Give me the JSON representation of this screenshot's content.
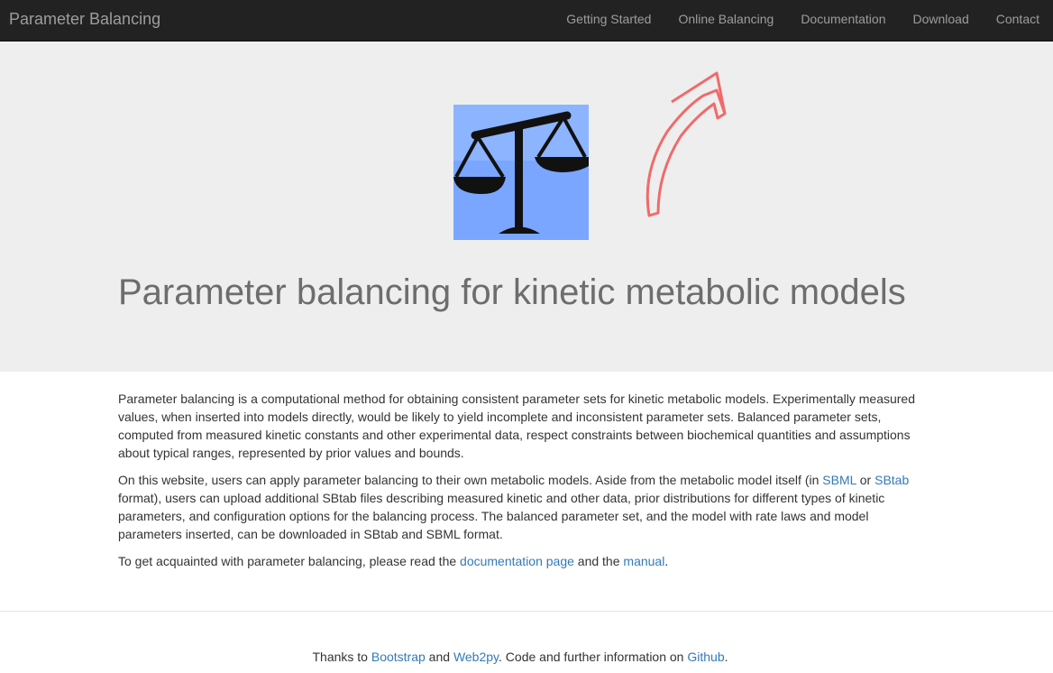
{
  "navbar": {
    "brand": "Parameter Balancing",
    "links": [
      "Getting Started",
      "Online Balancing",
      "Documentation",
      "Download",
      "Contact"
    ]
  },
  "hero": {
    "title": "Parameter balancing for kinetic metabolic models",
    "logo_icon": "balance-scale-icon",
    "logo_bg": "#7aa6ff",
    "annotation_icon": "red-arrow-annotation-icon",
    "annotation_color": "#f06a6a"
  },
  "content": {
    "p1": "Parameter balancing is a computational method for obtaining consistent parameter sets for kinetic metabolic models. Experimentally measured values, when inserted into models directly, would be likely to yield incomplete and inconsistent parameter sets. Balanced parameter sets, computed from measured kinetic constants and other experimental data, respect constraints between biochemical quantities and assumptions about typical ranges, represented by prior values and bounds.",
    "p2": {
      "t1": "On this website, users can apply parameter balancing to their own metabolic models. Aside from the metabolic model itself (in ",
      "l1": "SBML",
      "t2": " or ",
      "l2": "SBtab",
      "t3": " format), users can upload additional SBtab files describing measured kinetic and other data, prior distributions for different types of kinetic parameters, and configuration options for the balancing process. The balanced parameter set, and the model with rate laws and model parameters inserted, can be downloaded in SBtab and SBML format."
    },
    "p3": {
      "t1": "To get acquainted with parameter balancing, please read the ",
      "l1": "documentation page",
      "t2": " and the ",
      "l2": "manual",
      "t3": "."
    }
  },
  "footer": {
    "t1": "Thanks to ",
    "l1": "Bootstrap",
    "t2": " and ",
    "l2": "Web2py",
    "t3": ". Code and further information on ",
    "l3": "Github",
    "t4": "."
  },
  "colors": {
    "navbar": "#222222",
    "hero": "#eeeeee",
    "link": "#337ab7"
  }
}
